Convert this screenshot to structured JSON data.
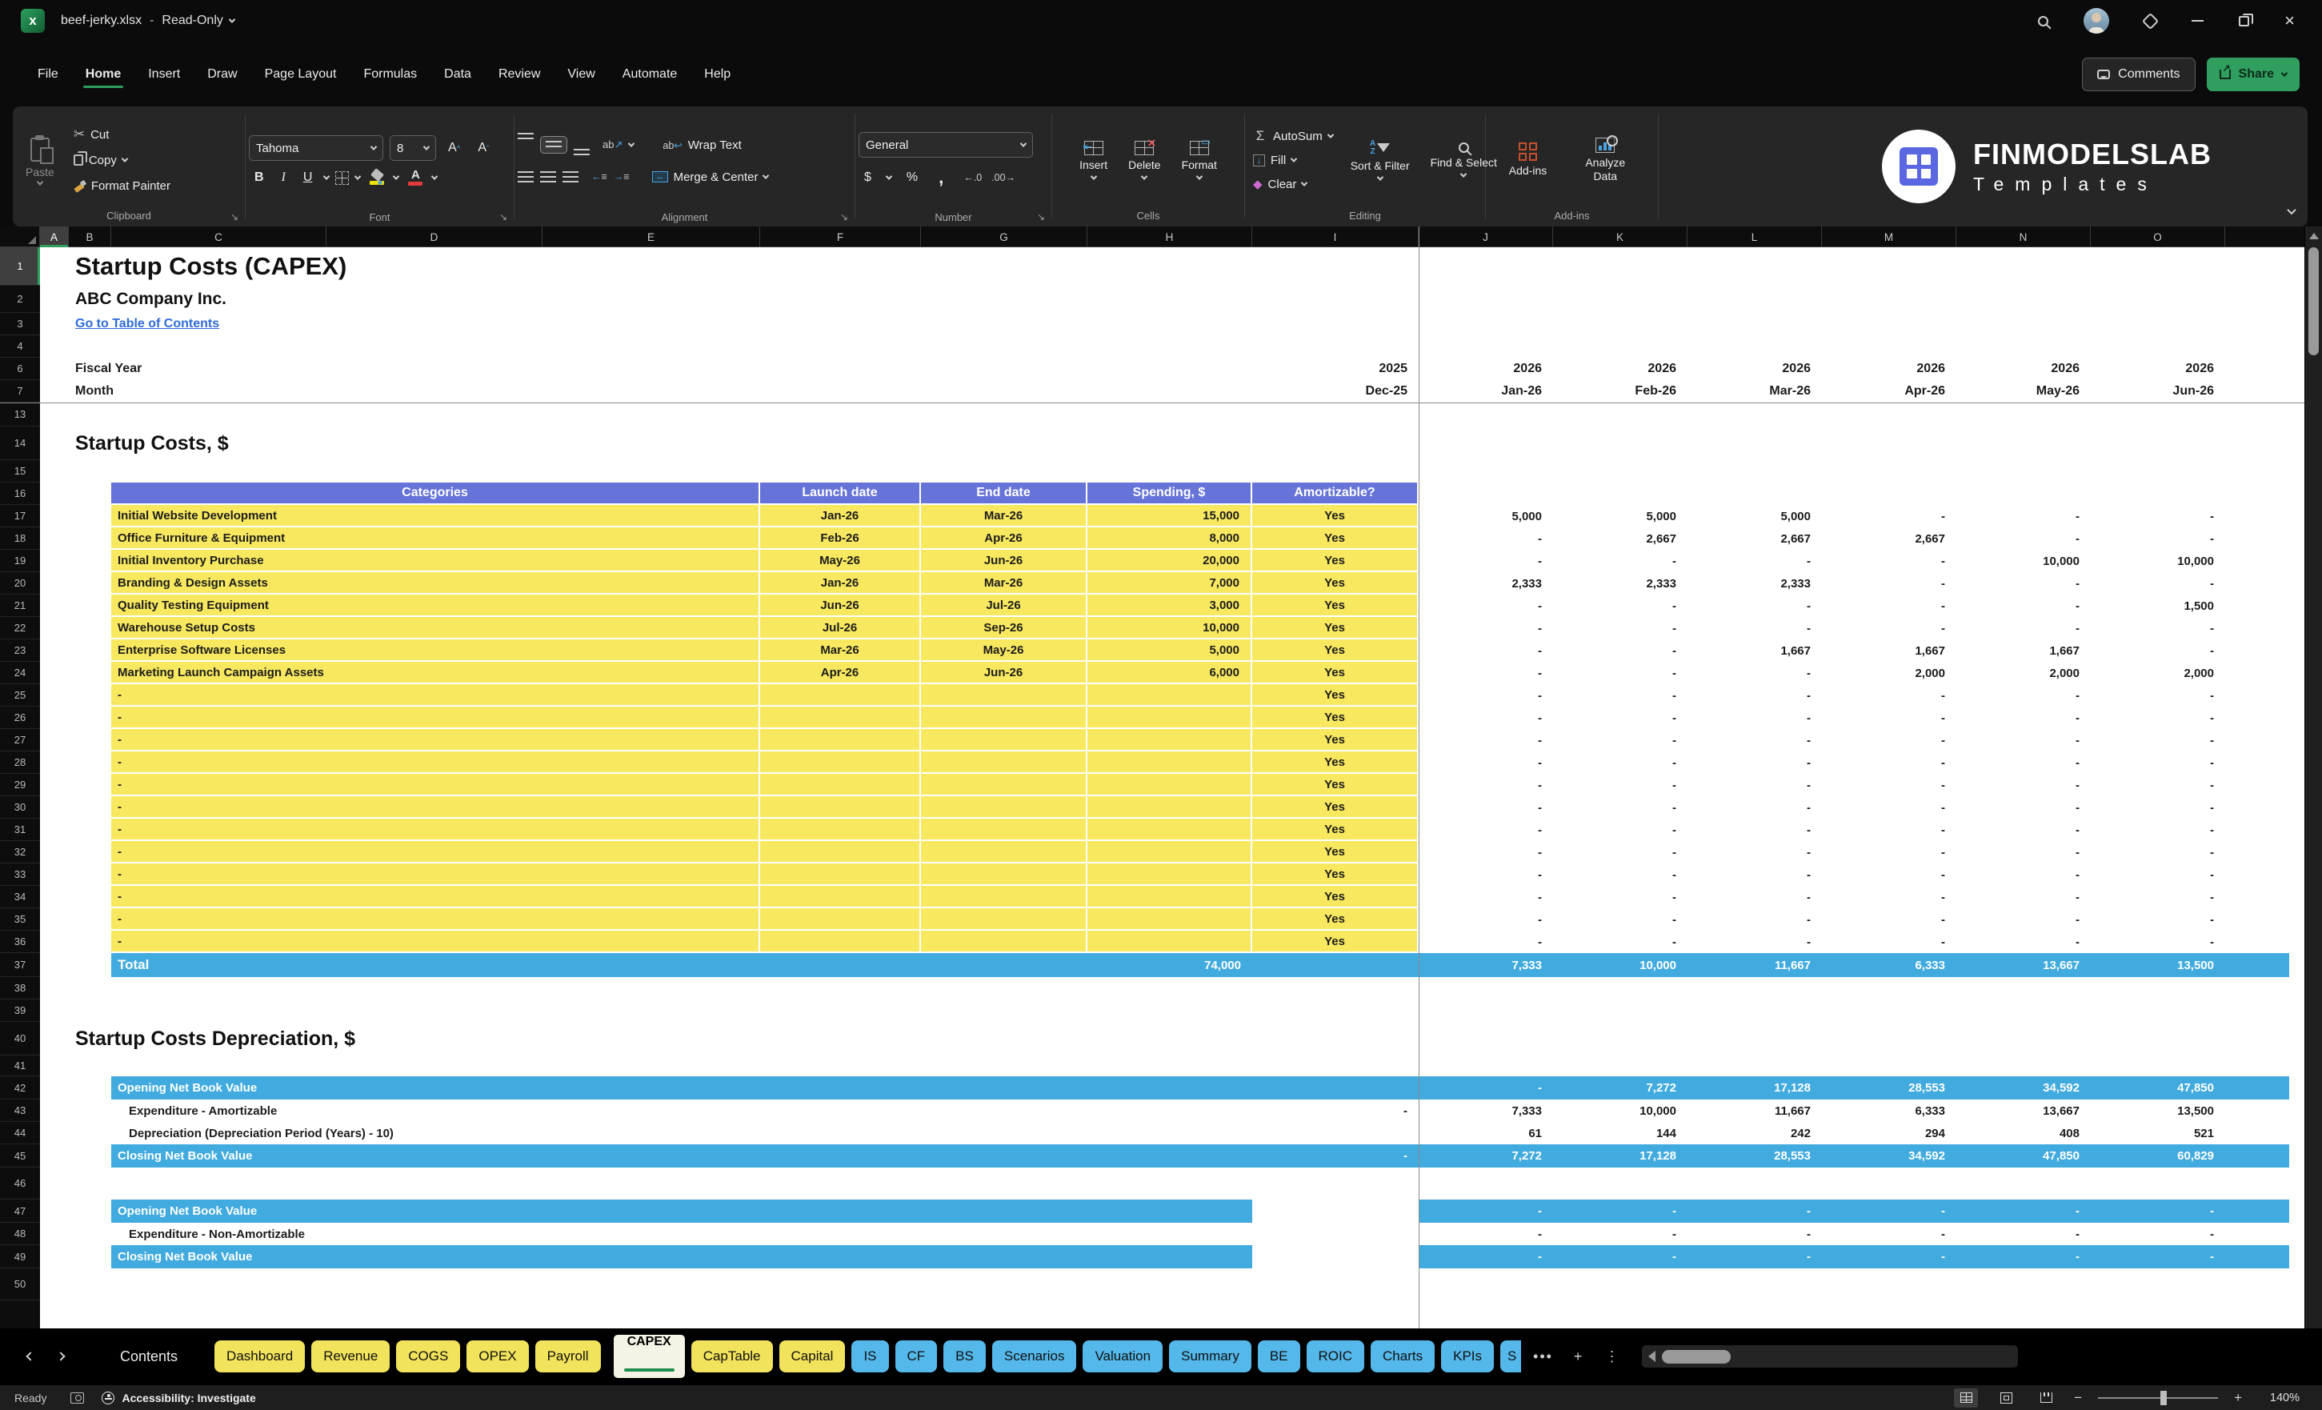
{
  "colors": {
    "accent_green": "#2f9e5f",
    "table_header_blue": "#6673d8",
    "table_yellow": "#f7e85f",
    "band_blue": "#41abdf",
    "link_blue": "#2e6bd9",
    "tab_yellow": "#f2e35c",
    "tab_blue": "#55b8ea",
    "addins_orange": "#c7502c"
  },
  "window": {
    "doc_title": "beef-jerky.xlsx",
    "separator": "-",
    "mode": "Read-Only",
    "comments": "Comments",
    "share": "Share"
  },
  "menu": {
    "items": [
      "File",
      "Home",
      "Insert",
      "Draw",
      "Page Layout",
      "Formulas",
      "Data",
      "Review",
      "View",
      "Automate",
      "Help"
    ],
    "active": "Home"
  },
  "ribbon": {
    "clipboard": {
      "paste": "Paste",
      "cut": "Cut",
      "copy": "Copy",
      "format_painter": "Format Painter",
      "label": "Clipboard"
    },
    "font": {
      "family": "Tahoma",
      "size": "8",
      "bold": "B",
      "italic": "I",
      "underline": "U",
      "label": "Font"
    },
    "alignment": {
      "wrap_text": "Wrap Text",
      "merge_center": "Merge & Center",
      "orient_ab": "ab",
      "label": "Alignment"
    },
    "number": {
      "format": "General",
      "currency": "$",
      "percent": "%",
      "comma": ",",
      "dec_inc": "←.0",
      "dec_dec": ".00→",
      "label": "Number"
    },
    "cells": {
      "insert": "Insert",
      "delete": "Delete",
      "format": "Format",
      "label": "Cells"
    },
    "editing": {
      "autosum": "AutoSum",
      "fill": "Fill",
      "clear": "Clear",
      "sort_filter": "Sort & Filter",
      "find_select": "Find & Select",
      "label": "Editing"
    },
    "addins": {
      "addins": "Add-ins",
      "analyze": "Analyze Data",
      "label": "Add-ins"
    },
    "brand": {
      "name": "FINMODELSLAB",
      "sub": "Templates"
    }
  },
  "sheet": {
    "columns": [
      "A",
      "B",
      "C",
      "D",
      "E",
      "F",
      "G",
      "H",
      "I",
      "J",
      "K",
      "L",
      "M",
      "N",
      "O"
    ],
    "row_numbers": [
      "1",
      "2",
      "3",
      "4",
      "6",
      "7",
      "13",
      "14",
      "15",
      "16",
      "17",
      "18",
      "19",
      "20",
      "21",
      "22",
      "23",
      "24",
      "25",
      "26",
      "27",
      "28",
      "29",
      "30",
      "31",
      "32",
      "33",
      "34",
      "35",
      "36",
      "37",
      "38",
      "39",
      "40",
      "41",
      "42",
      "43",
      "44",
      "45",
      "46",
      "47",
      "48",
      "49",
      "50"
    ],
    "title": "Startup Costs (CAPEX)",
    "company": "ABC Company Inc.",
    "toc_link": "Go to Table of Contents",
    "fiscal_year_label": "Fiscal Year",
    "month_label": "Month",
    "fiscal_years": [
      "2025",
      "2026",
      "2026",
      "2026",
      "2026",
      "2026",
      "2026"
    ],
    "months": [
      "Dec-25",
      "Jan-26",
      "Feb-26",
      "Mar-26",
      "Apr-26",
      "May-26",
      "Jun-26"
    ],
    "section1": "Startup Costs, $",
    "table": {
      "headers": {
        "categories": "Categories",
        "launch": "Launch date",
        "end": "End date",
        "spending": "Spending, $",
        "amortizable": "Amortizable?"
      },
      "rows": [
        {
          "category": "Initial Website Development",
          "launch": "Jan-26",
          "end": "Mar-26",
          "spending": "15,000",
          "amortizable": "Yes",
          "monthly": [
            "5,000",
            "5,000",
            "5,000",
            "-",
            "-",
            "-"
          ]
        },
        {
          "category": "Office Furniture & Equipment",
          "launch": "Feb-26",
          "end": "Apr-26",
          "spending": "8,000",
          "amortizable": "Yes",
          "monthly": [
            "-",
            "2,667",
            "2,667",
            "2,667",
            "-",
            "-"
          ]
        },
        {
          "category": "Initial Inventory Purchase",
          "launch": "May-26",
          "end": "Jun-26",
          "spending": "20,000",
          "amortizable": "Yes",
          "monthly": [
            "-",
            "-",
            "-",
            "-",
            "10,000",
            "10,000"
          ]
        },
        {
          "category": "Branding & Design Assets",
          "launch": "Jan-26",
          "end": "Mar-26",
          "spending": "7,000",
          "amortizable": "Yes",
          "monthly": [
            "2,333",
            "2,333",
            "2,333",
            "-",
            "-",
            "-"
          ]
        },
        {
          "category": "Quality Testing Equipment",
          "launch": "Jun-26",
          "end": "Jul-26",
          "spending": "3,000",
          "amortizable": "Yes",
          "monthly": [
            "-",
            "-",
            "-",
            "-",
            "-",
            "1,500"
          ]
        },
        {
          "category": "Warehouse Setup Costs",
          "launch": "Jul-26",
          "end": "Sep-26",
          "spending": "10,000",
          "amortizable": "Yes",
          "monthly": [
            "-",
            "-",
            "-",
            "-",
            "-",
            "-"
          ]
        },
        {
          "category": "Enterprise Software Licenses",
          "launch": "Mar-26",
          "end": "May-26",
          "spending": "5,000",
          "amortizable": "Yes",
          "monthly": [
            "-",
            "-",
            "1,667",
            "1,667",
            "1,667",
            "-"
          ]
        },
        {
          "category": "Marketing Launch Campaign Assets",
          "launch": "Apr-26",
          "end": "Jun-26",
          "spending": "6,000",
          "amortizable": "Yes",
          "monthly": [
            "-",
            "-",
            "-",
            "2,000",
            "2,000",
            "2,000"
          ]
        }
      ],
      "empty_row": {
        "category": "-",
        "launch": "",
        "end": "",
        "spending": "",
        "amortizable": "Yes",
        "monthly": [
          "-",
          "-",
          "-",
          "-",
          "-",
          "-"
        ]
      },
      "empty_row_count": 12
    },
    "total": {
      "label": "Total",
      "spending": "74,000",
      "monthly": [
        "7,333",
        "10,000",
        "11,667",
        "6,333",
        "13,667",
        "13,500"
      ]
    },
    "section2": "Startup Costs Depreciation, $",
    "depreciation_amortizable": [
      {
        "label": "Opening Net Book Value",
        "type": "band",
        "monthly": [
          "-",
          "7,272",
          "17,128",
          "28,553",
          "34,592",
          "47,850"
        ]
      },
      {
        "label": "Expenditure - Amortizable",
        "type": "plain",
        "col_i": "-",
        "monthly": [
          "7,333",
          "10,000",
          "11,667",
          "6,333",
          "13,667",
          "13,500"
        ]
      },
      {
        "label": "Depreciation (Depreciation Period (Years) - 10)",
        "type": "plain",
        "monthly": [
          "61",
          "144",
          "242",
          "294",
          "408",
          "521"
        ]
      },
      {
        "label": "Closing Net Book Value",
        "type": "band",
        "col_i": "-",
        "monthly": [
          "7,272",
          "17,128",
          "28,553",
          "34,592",
          "47,850",
          "60,829"
        ]
      }
    ],
    "depreciation_non_amortizable": [
      {
        "label": "Opening Net Book Value",
        "type": "band",
        "band_gap_i": true,
        "monthly": [
          "-",
          "-",
          "-",
          "-",
          "-",
          "-"
        ]
      },
      {
        "label": "Expenditure - Non-Amortizable",
        "type": "plain",
        "monthly": [
          "-",
          "-",
          "-",
          "-",
          "-",
          "-"
        ]
      },
      {
        "label": "Closing Net Book Value",
        "type": "band",
        "band_gap_i": true,
        "monthly": [
          "-",
          "-",
          "-",
          "-",
          "-",
          "-"
        ]
      }
    ]
  },
  "tabs": {
    "contents": "Contents",
    "yellow_before": [
      "Dashboard",
      "Revenue",
      "COGS",
      "OPEX",
      "Payroll"
    ],
    "active": "CAPEX",
    "yellow_after": [
      "CapTable",
      "Capital"
    ],
    "blue": [
      "IS",
      "CF",
      "BS",
      "Scenarios",
      "Valuation",
      "Summary",
      "BE",
      "ROIC",
      "Charts",
      "KPIs",
      "S"
    ],
    "overflow": "•••",
    "add": "+",
    "more": "⋮"
  },
  "status": {
    "ready": "Ready",
    "accessibility": "Accessibility: Investigate",
    "zoom_minus": "−",
    "zoom_plus": "+",
    "zoom_level": "140%"
  }
}
